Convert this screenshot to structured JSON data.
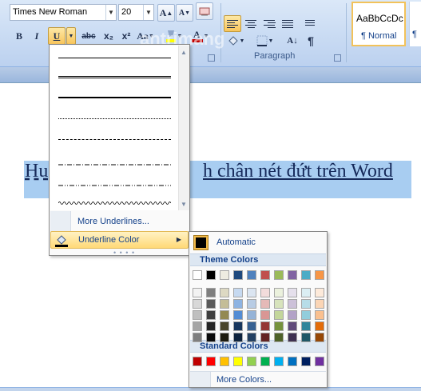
{
  "ribbon": {
    "font_name": "Times New Roman",
    "font_size": "20",
    "bold": "B",
    "italic": "I",
    "underline": "U",
    "strike": "abc",
    "subscript": "x₂",
    "superscript": "x²",
    "change_case": "Aa",
    "grow_font": "A",
    "shrink_font": "A",
    "paragraph_mark": "¶",
    "paragraph_label": "Paragraph",
    "style_sample": "AaBbCcDc",
    "style_name": "¶ Normal",
    "style_next": "¶"
  },
  "watermark": "antrimang",
  "document": {
    "text_left": "Hu",
    "text_right": "h chân nét đứt trên Word"
  },
  "underline_menu": {
    "more_underlines": "More Underlines...",
    "underline_color": "Underline Color",
    "grip": "• • • •"
  },
  "color_menu": {
    "automatic": "Automatic",
    "theme_colors": "Theme Colors",
    "standard_colors": "Standard Colors",
    "more_colors": "More Colors...",
    "theme_palette": [
      [
        "#ffffff",
        "#000000",
        "#eeece1",
        "#1f497d",
        "#4f81bd",
        "#c0504d",
        "#9bbb59",
        "#8064a2",
        "#4bacc6",
        "#f79646"
      ],
      [
        "#f2f2f2",
        "#7f7f7f",
        "#ddd9c3",
        "#c6d9f0",
        "#dbe5f1",
        "#f2dcdb",
        "#ebf1dd",
        "#e5e0ec",
        "#dbeef3",
        "#fdeada"
      ],
      [
        "#d8d8d8",
        "#595959",
        "#c4bd97",
        "#8db3e2",
        "#b8cce4",
        "#e5b9b7",
        "#d7e3bc",
        "#ccc1d9",
        "#b7dde8",
        "#fbd5b5"
      ],
      [
        "#bfbfbf",
        "#3f3f3f",
        "#938953",
        "#548dd4",
        "#95b3d7",
        "#d99694",
        "#c3d69b",
        "#b2a2c7",
        "#92cddc",
        "#fac08f"
      ],
      [
        "#a5a5a5",
        "#262626",
        "#494429",
        "#17365d",
        "#366092",
        "#953734",
        "#76923c",
        "#5f497a",
        "#31859b",
        "#e36c09"
      ],
      [
        "#7f7f7f",
        "#0c0c0c",
        "#1d1b10",
        "#0f243e",
        "#244061",
        "#632423",
        "#4f6128",
        "#3f3151",
        "#205867",
        "#974806"
      ]
    ],
    "standard_palette": [
      "#c00000",
      "#ff0000",
      "#ffc000",
      "#ffff00",
      "#92d050",
      "#00b050",
      "#00b0f0",
      "#0070c0",
      "#002060",
      "#7030a0"
    ]
  }
}
